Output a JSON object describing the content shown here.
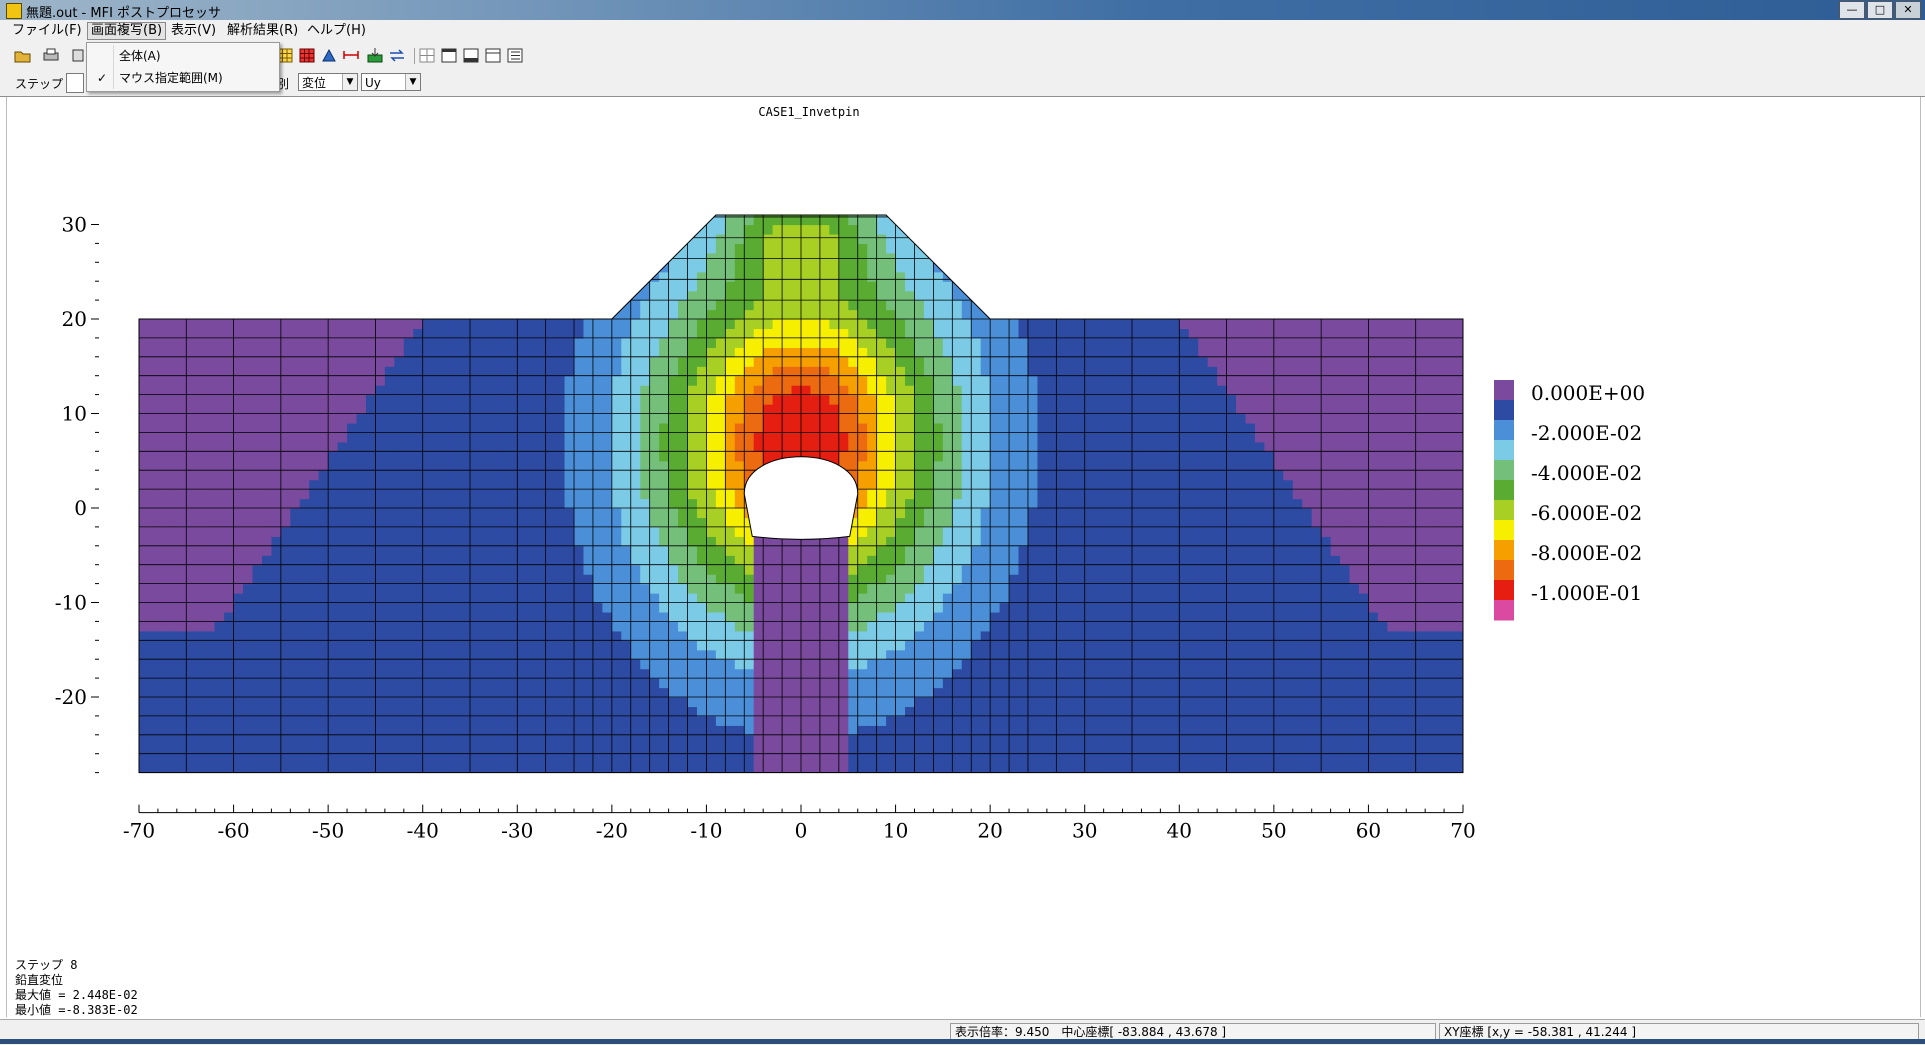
{
  "window": {
    "title": "無題.out - MFI ポストプロセッサ",
    "buttons": [
      "—",
      "□",
      "✕"
    ]
  },
  "menu": [
    {
      "label": "ファイル(F)",
      "active": false
    },
    {
      "label": "画面複写(B)",
      "active": true
    },
    {
      "label": "表示(V)",
      "active": false
    },
    {
      "label": "解析結果(R)",
      "active": false
    },
    {
      "label": "ヘルプ(H)",
      "active": false
    }
  ],
  "toolbar": {
    "icons": [
      "open-icon",
      "print-icon",
      "copy-icon",
      "mesh-icon",
      "contour-icon",
      "vector-icon",
      "dimension-icon",
      "export-icon",
      "mns-icon",
      "grid-view-icon",
      "window-1-icon",
      "window-2-icon",
      "window-3-icon",
      "list-view-icon"
    ],
    "step_label": "ステップ",
    "type_label": "別",
    "result_select": "変位",
    "component_select": "Uy"
  },
  "dropdown": {
    "items": [
      {
        "label": "全体(A)",
        "checked": false
      },
      {
        "label": "マウス指定範囲(M)",
        "checked": true
      }
    ]
  },
  "chart_data": {
    "type": "heatmap",
    "title": "CASE1_Invetpin",
    "xlabel": "",
    "ylabel": "",
    "xlim": [
      -70,
      70
    ],
    "ylim": [
      -28,
      31
    ],
    "xticks": [
      -70,
      -60,
      -50,
      -40,
      -30,
      -20,
      -10,
      0,
      10,
      20,
      30,
      40,
      50,
      60,
      70
    ],
    "yticks": [
      30,
      20,
      10,
      0,
      -10,
      -20
    ],
    "ground_surface": 20,
    "embankment": {
      "top_y": 31,
      "top_x": [
        -9,
        9
      ],
      "base_x": [
        -20,
        20
      ]
    },
    "tunnel": {
      "center_y": 1.5,
      "half_width": 6,
      "crown_y": 6.3,
      "invert_y": -3
    },
    "legend": {
      "labels": [
        "0.000E+00",
        "-2.000E-02",
        "-4.000E-02",
        "-6.000E-02",
        "-8.000E-02",
        "-1.000E-01"
      ],
      "colors": [
        "#7a4a9e",
        "#2e4ba4",
        "#4b8fd8",
        "#7ccbe6",
        "#74c07a",
        "#5aab32",
        "#a8d024",
        "#f6f000",
        "#f5a000",
        "#ec6a10",
        "#e41e10",
        "#d94aa0"
      ]
    },
    "mesh_x": [
      -70,
      -65,
      -60,
      -55,
      -50,
      -45,
      -40,
      -35,
      -30,
      -27,
      -24,
      -22,
      -20,
      -18,
      -16,
      -14,
      -12,
      -10,
      -8,
      -6,
      -4,
      -2,
      0,
      2,
      4,
      6,
      8,
      10,
      12,
      14,
      16,
      18,
      20,
      22,
      24,
      27,
      30,
      35,
      40,
      45,
      50,
      55,
      60,
      65,
      70
    ],
    "mesh_y": [
      -28,
      -26,
      -24,
      -22,
      -20,
      -18,
      -16,
      -14,
      -12,
      -10,
      -8,
      -6,
      -4,
      -2,
      0,
      2,
      4,
      6,
      8,
      10,
      12,
      14,
      16,
      18,
      20
    ]
  },
  "info": {
    "lines": [
      "ステップ 8",
      "鉛直変位",
      "最大値 = 2.448E-02",
      "最小値 =-8.383E-02"
    ]
  },
  "status": {
    "scale": "表示倍率：9.450　中心座標[ -83.884 , 43.678 ]",
    "xy": "XY座標 [x,y  =  -58.381 , 41.244 ]"
  }
}
